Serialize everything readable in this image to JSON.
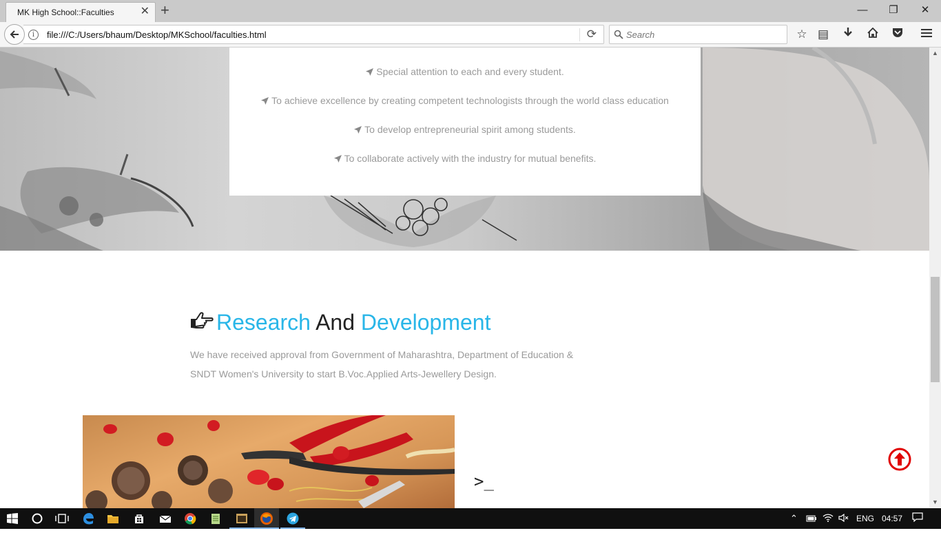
{
  "browser": {
    "tab_title": "MK High School::Faculties",
    "tab_close": "✕",
    "new_tab": "+",
    "url": "file:///C:/Users/bhaum/Desktop/MKSchool/faculties.html",
    "search_placeholder": "Search",
    "window_controls": {
      "minimize": "—",
      "restore": "❐",
      "close": "✕"
    },
    "toolbar_icons": [
      "star-icon",
      "reading-list-icon",
      "download-icon",
      "home-icon",
      "pocket-icon",
      "menu-icon"
    ]
  },
  "page": {
    "mission_items": [
      "Special attention to each and every student.",
      "To achieve excellence by creating competent technologists through the world class education",
      "To develop entrepreneurial spirit among students.",
      "To collaborate actively with the industry for mutual benefits."
    ],
    "rd_heading": {
      "word1": "Research",
      "word2": "And",
      "word3": "Development"
    },
    "rd_text": "We have received approval from Government of Maharashtra, Department of Education & SNDT Women's University to start B.Voc.Applied Arts-Jewellery Design.",
    "terminal_glyph": ">_",
    "colors": {
      "accent": "#29b6e8",
      "back_to_top": "#e00000"
    }
  },
  "taskbar": {
    "language": "ENG",
    "time": "04:57"
  }
}
